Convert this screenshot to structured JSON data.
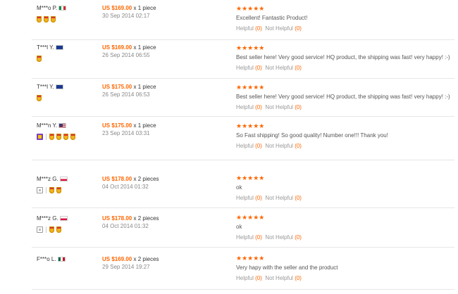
{
  "reviews": [
    {
      "name": "M***o P.",
      "country": "it",
      "medals": 3,
      "vip": "none",
      "price": "US $169.00",
      "qty": "x 1 piece",
      "date": "30 Sep 2014 02:17",
      "stars": "★★★★★",
      "comment": "Excellent! Fantastic Product!",
      "helpful_label": "Helpful",
      "helpful": "(0)",
      "not_helpful_label": "Not Helpful",
      "not_helpful": "(0)"
    },
    {
      "name": "T***l Y.",
      "country": "au",
      "medals": 1,
      "vip": "none",
      "price": "US $169.00",
      "qty": "x 1 piece",
      "date": "26 Sep 2014 06:55",
      "stars": "★★★★★",
      "comment": "Best seller here! Very good service! HQ product, the shipping was fast! very happy! :-)",
      "helpful_label": "Helpful",
      "helpful": "(0)",
      "not_helpful_label": "Not Helpful",
      "not_helpful": "(0)"
    },
    {
      "name": "T***l Y.",
      "country": "au",
      "medals": 1,
      "vip": "none",
      "price": "US $175.00",
      "qty": "x 1 piece",
      "date": "26 Sep 2014 06:53",
      "stars": "★★★★★",
      "comment": "Best seller here! Very good service! HQ product, the shipping was fast! very happy! :-)",
      "helpful_label": "Helpful",
      "helpful": "(0)",
      "not_helpful_label": "Not Helpful",
      "not_helpful": "(0)"
    },
    {
      "name": "M***n Y.",
      "country": "us",
      "medals": 4,
      "vip": "purple",
      "price": "US $175.00",
      "qty": "x 1 piece",
      "date": "23 Sep 2014 03:31",
      "stars": "★★★★★",
      "comment": "So Fast shipping! So good quality! Number one!!! Thank you!",
      "helpful_label": "Helpful",
      "helpful": "(0)",
      "not_helpful_label": "Not Helpful",
      "not_helpful": "(0)"
    },
    {
      "name": "M***z G.",
      "country": "pl",
      "medals": 2,
      "vip": "gray",
      "price": "US $178.00",
      "qty": "x 2 pieces",
      "date": "04 Oct 2014 01:32",
      "stars": "★★★★★",
      "comment": "ok",
      "helpful_label": "Helpful",
      "helpful": "(0)",
      "not_helpful_label": "Not Helpful",
      "not_helpful": "(0)"
    },
    {
      "name": "M***z G.",
      "country": "pl",
      "medals": 2,
      "vip": "gray",
      "price": "US $178.00",
      "qty": "x 2 pieces",
      "date": "04 Oct 2014 01:32",
      "stars": "★★★★★",
      "comment": "ok",
      "helpful_label": "Helpful",
      "helpful": "(0)",
      "not_helpful_label": "Not Helpful",
      "not_helpful": "(0)"
    },
    {
      "name": "F***o L.",
      "country": "mx",
      "medals": 0,
      "vip": "none",
      "price": "US $169.00",
      "qty": "x 2 pieces",
      "date": "29 Sep 2014 19:27",
      "stars": "★★★★★",
      "comment": "Very hapy with the seller and the product",
      "helpful_label": "Helpful",
      "helpful": "(0)",
      "not_helpful_label": "Not Helpful",
      "not_helpful": "(0)"
    }
  ]
}
